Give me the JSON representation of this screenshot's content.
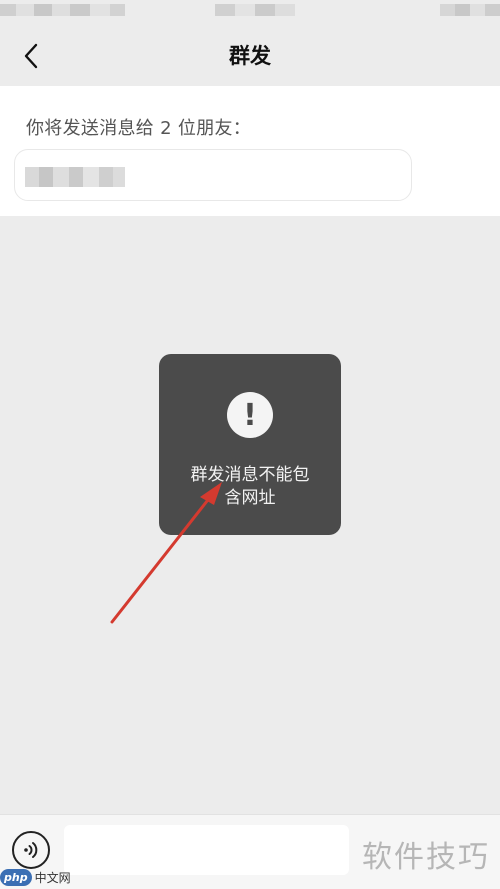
{
  "nav": {
    "title": "群发"
  },
  "recipient": {
    "hint": "你将发送消息给 2 位朋友："
  },
  "toast": {
    "icon": "!",
    "message_line1": "群发消息不能包",
    "message_line2": "含网址"
  },
  "icons": {
    "back": "chevron-left-icon",
    "voice": "voice-icon",
    "alert": "exclamation-icon"
  },
  "watermarks": {
    "right_text": "软件技巧",
    "php_badge": "php",
    "php_site": "中文网"
  },
  "colors": {
    "page_background": "#ececec",
    "toast_background": "#4b4b4b",
    "annotation_arrow": "#d43a2f"
  }
}
